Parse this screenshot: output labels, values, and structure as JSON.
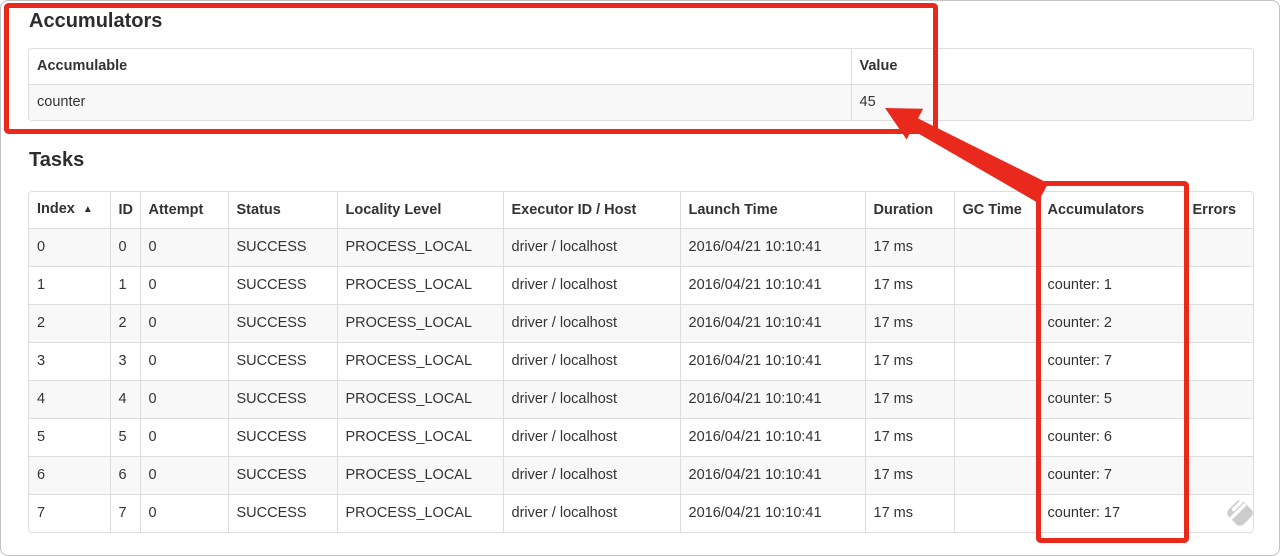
{
  "colors": {
    "annotation_red": "#e8291c",
    "table_border": "#dddddd",
    "stripe_row": "#f8f8f8",
    "text": "#333333",
    "watermark_gray": "#cccccc"
  },
  "accumulators_section": {
    "title": "Accumulators",
    "table": {
      "headers": [
        "Accumulable",
        "Value"
      ],
      "rows": [
        [
          "counter",
          "45"
        ]
      ]
    }
  },
  "tasks_section": {
    "title": "Tasks",
    "table": {
      "sort_indicator": "▲",
      "headers": [
        "Index",
        "ID",
        "Attempt",
        "Status",
        "Locality Level",
        "Executor ID / Host",
        "Launch Time",
        "Duration",
        "GC Time",
        "Accumulators",
        "Errors"
      ],
      "rows": [
        [
          "0",
          "0",
          "0",
          "SUCCESS",
          "PROCESS_LOCAL",
          "driver / localhost",
          "2016/04/21 10:10:41",
          "17 ms",
          "",
          "",
          ""
        ],
        [
          "1",
          "1",
          "0",
          "SUCCESS",
          "PROCESS_LOCAL",
          "driver / localhost",
          "2016/04/21 10:10:41",
          "17 ms",
          "",
          "counter: 1",
          ""
        ],
        [
          "2",
          "2",
          "0",
          "SUCCESS",
          "PROCESS_LOCAL",
          "driver / localhost",
          "2016/04/21 10:10:41",
          "17 ms",
          "",
          "counter: 2",
          ""
        ],
        [
          "3",
          "3",
          "0",
          "SUCCESS",
          "PROCESS_LOCAL",
          "driver / localhost",
          "2016/04/21 10:10:41",
          "17 ms",
          "",
          "counter: 7",
          ""
        ],
        [
          "4",
          "4",
          "0",
          "SUCCESS",
          "PROCESS_LOCAL",
          "driver / localhost",
          "2016/04/21 10:10:41",
          "17 ms",
          "",
          "counter: 5",
          ""
        ],
        [
          "5",
          "5",
          "0",
          "SUCCESS",
          "PROCESS_LOCAL",
          "driver / localhost",
          "2016/04/21 10:10:41",
          "17 ms",
          "",
          "counter: 6",
          ""
        ],
        [
          "6",
          "6",
          "0",
          "SUCCESS",
          "PROCESS_LOCAL",
          "driver / localhost",
          "2016/04/21 10:10:41",
          "17 ms",
          "",
          "counter: 7",
          ""
        ],
        [
          "7",
          "7",
          "0",
          "SUCCESS",
          "PROCESS_LOCAL",
          "driver / localhost",
          "2016/04/21 10:10:41",
          "17 ms",
          "",
          "counter: 17",
          ""
        ]
      ]
    }
  }
}
